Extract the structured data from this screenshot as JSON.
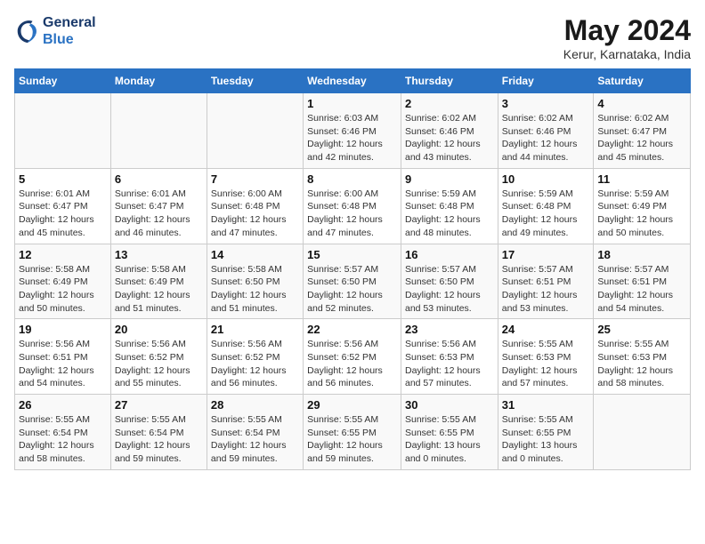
{
  "header": {
    "logo_line1": "General",
    "logo_line2": "Blue",
    "title": "May 2024",
    "subtitle": "Kerur, Karnataka, India"
  },
  "weekdays": [
    "Sunday",
    "Monday",
    "Tuesday",
    "Wednesday",
    "Thursday",
    "Friday",
    "Saturday"
  ],
  "weeks": [
    [
      {
        "day": "",
        "info": ""
      },
      {
        "day": "",
        "info": ""
      },
      {
        "day": "",
        "info": ""
      },
      {
        "day": "1",
        "info": "Sunrise: 6:03 AM\nSunset: 6:46 PM\nDaylight: 12 hours\nand 42 minutes."
      },
      {
        "day": "2",
        "info": "Sunrise: 6:02 AM\nSunset: 6:46 PM\nDaylight: 12 hours\nand 43 minutes."
      },
      {
        "day": "3",
        "info": "Sunrise: 6:02 AM\nSunset: 6:46 PM\nDaylight: 12 hours\nand 44 minutes."
      },
      {
        "day": "4",
        "info": "Sunrise: 6:02 AM\nSunset: 6:47 PM\nDaylight: 12 hours\nand 45 minutes."
      }
    ],
    [
      {
        "day": "5",
        "info": "Sunrise: 6:01 AM\nSunset: 6:47 PM\nDaylight: 12 hours\nand 45 minutes."
      },
      {
        "day": "6",
        "info": "Sunrise: 6:01 AM\nSunset: 6:47 PM\nDaylight: 12 hours\nand 46 minutes."
      },
      {
        "day": "7",
        "info": "Sunrise: 6:00 AM\nSunset: 6:48 PM\nDaylight: 12 hours\nand 47 minutes."
      },
      {
        "day": "8",
        "info": "Sunrise: 6:00 AM\nSunset: 6:48 PM\nDaylight: 12 hours\nand 47 minutes."
      },
      {
        "day": "9",
        "info": "Sunrise: 5:59 AM\nSunset: 6:48 PM\nDaylight: 12 hours\nand 48 minutes."
      },
      {
        "day": "10",
        "info": "Sunrise: 5:59 AM\nSunset: 6:48 PM\nDaylight: 12 hours\nand 49 minutes."
      },
      {
        "day": "11",
        "info": "Sunrise: 5:59 AM\nSunset: 6:49 PM\nDaylight: 12 hours\nand 50 minutes."
      }
    ],
    [
      {
        "day": "12",
        "info": "Sunrise: 5:58 AM\nSunset: 6:49 PM\nDaylight: 12 hours\nand 50 minutes."
      },
      {
        "day": "13",
        "info": "Sunrise: 5:58 AM\nSunset: 6:49 PM\nDaylight: 12 hours\nand 51 minutes."
      },
      {
        "day": "14",
        "info": "Sunrise: 5:58 AM\nSunset: 6:50 PM\nDaylight: 12 hours\nand 51 minutes."
      },
      {
        "day": "15",
        "info": "Sunrise: 5:57 AM\nSunset: 6:50 PM\nDaylight: 12 hours\nand 52 minutes."
      },
      {
        "day": "16",
        "info": "Sunrise: 5:57 AM\nSunset: 6:50 PM\nDaylight: 12 hours\nand 53 minutes."
      },
      {
        "day": "17",
        "info": "Sunrise: 5:57 AM\nSunset: 6:51 PM\nDaylight: 12 hours\nand 53 minutes."
      },
      {
        "day": "18",
        "info": "Sunrise: 5:57 AM\nSunset: 6:51 PM\nDaylight: 12 hours\nand 54 minutes."
      }
    ],
    [
      {
        "day": "19",
        "info": "Sunrise: 5:56 AM\nSunset: 6:51 PM\nDaylight: 12 hours\nand 54 minutes."
      },
      {
        "day": "20",
        "info": "Sunrise: 5:56 AM\nSunset: 6:52 PM\nDaylight: 12 hours\nand 55 minutes."
      },
      {
        "day": "21",
        "info": "Sunrise: 5:56 AM\nSunset: 6:52 PM\nDaylight: 12 hours\nand 56 minutes."
      },
      {
        "day": "22",
        "info": "Sunrise: 5:56 AM\nSunset: 6:52 PM\nDaylight: 12 hours\nand 56 minutes."
      },
      {
        "day": "23",
        "info": "Sunrise: 5:56 AM\nSunset: 6:53 PM\nDaylight: 12 hours\nand 57 minutes."
      },
      {
        "day": "24",
        "info": "Sunrise: 5:55 AM\nSunset: 6:53 PM\nDaylight: 12 hours\nand 57 minutes."
      },
      {
        "day": "25",
        "info": "Sunrise: 5:55 AM\nSunset: 6:53 PM\nDaylight: 12 hours\nand 58 minutes."
      }
    ],
    [
      {
        "day": "26",
        "info": "Sunrise: 5:55 AM\nSunset: 6:54 PM\nDaylight: 12 hours\nand 58 minutes."
      },
      {
        "day": "27",
        "info": "Sunrise: 5:55 AM\nSunset: 6:54 PM\nDaylight: 12 hours\nand 59 minutes."
      },
      {
        "day": "28",
        "info": "Sunrise: 5:55 AM\nSunset: 6:54 PM\nDaylight: 12 hours\nand 59 minutes."
      },
      {
        "day": "29",
        "info": "Sunrise: 5:55 AM\nSunset: 6:55 PM\nDaylight: 12 hours\nand 59 minutes."
      },
      {
        "day": "30",
        "info": "Sunrise: 5:55 AM\nSunset: 6:55 PM\nDaylight: 13 hours\nand 0 minutes."
      },
      {
        "day": "31",
        "info": "Sunrise: 5:55 AM\nSunset: 6:55 PM\nDaylight: 13 hours\nand 0 minutes."
      },
      {
        "day": "",
        "info": ""
      }
    ]
  ]
}
